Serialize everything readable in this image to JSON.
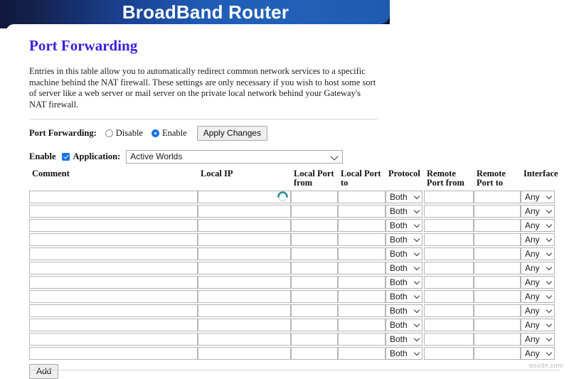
{
  "header": {
    "title": "BroadBand Router"
  },
  "page": {
    "title": "Port Forwarding",
    "description": "Entries in this table allow you to automatically redirect common network services to a specific machine behind the NAT firewall. These settings are only necessary if you wish to host some sort of server like a web server or mail server on the private local network behind your Gateway's NAT firewall."
  },
  "controls": {
    "port_forwarding_label": "Port Forwarding:",
    "disable_label": "Disable",
    "enable_label": "Enable",
    "selected_mode": "Enable",
    "apply_label": "Apply Changes",
    "enable_checkbox_label": "Enable",
    "enable_checkbox_checked": true,
    "application_label": "Application:",
    "application_value": "Active Worlds"
  },
  "table": {
    "headers": [
      "Comment",
      "Local IP",
      "Local Port from",
      "Local Port to",
      "Protocol",
      "Remote Port from",
      "Remote Port to",
      "Interface"
    ],
    "row_count": 12,
    "protocol_value": "Both",
    "interface_value": "Any",
    "rows": [
      {
        "comment": "",
        "local_ip": "",
        "local_port_from": "",
        "local_port_to": "",
        "protocol": "Both",
        "remote_port_from": "",
        "remote_port_to": "",
        "interface": "Any",
        "loading": true
      },
      {
        "comment": "",
        "local_ip": "",
        "local_port_from": "",
        "local_port_to": "",
        "protocol": "Both",
        "remote_port_from": "",
        "remote_port_to": "",
        "interface": "Any",
        "loading": false
      },
      {
        "comment": "",
        "local_ip": "",
        "local_port_from": "",
        "local_port_to": "",
        "protocol": "Both",
        "remote_port_from": "",
        "remote_port_to": "",
        "interface": "Any",
        "loading": false
      },
      {
        "comment": "",
        "local_ip": "",
        "local_port_from": "",
        "local_port_to": "",
        "protocol": "Both",
        "remote_port_from": "",
        "remote_port_to": "",
        "interface": "Any",
        "loading": false
      },
      {
        "comment": "",
        "local_ip": "",
        "local_port_from": "",
        "local_port_to": "",
        "protocol": "Both",
        "remote_port_from": "",
        "remote_port_to": "",
        "interface": "Any",
        "loading": false
      },
      {
        "comment": "",
        "local_ip": "",
        "local_port_from": "",
        "local_port_to": "",
        "protocol": "Both",
        "remote_port_from": "",
        "remote_port_to": "",
        "interface": "Any",
        "loading": false
      },
      {
        "comment": "",
        "local_ip": "",
        "local_port_from": "",
        "local_port_to": "",
        "protocol": "Both",
        "remote_port_from": "",
        "remote_port_to": "",
        "interface": "Any",
        "loading": false
      },
      {
        "comment": "",
        "local_ip": "",
        "local_port_from": "",
        "local_port_to": "",
        "protocol": "Both",
        "remote_port_from": "",
        "remote_port_to": "",
        "interface": "Any",
        "loading": false
      },
      {
        "comment": "",
        "local_ip": "",
        "local_port_from": "",
        "local_port_to": "",
        "protocol": "Both",
        "remote_port_from": "",
        "remote_port_to": "",
        "interface": "Any",
        "loading": false
      },
      {
        "comment": "",
        "local_ip": "",
        "local_port_from": "",
        "local_port_to": "",
        "protocol": "Both",
        "remote_port_from": "",
        "remote_port_to": "",
        "interface": "Any",
        "loading": false
      },
      {
        "comment": "",
        "local_ip": "",
        "local_port_from": "",
        "local_port_to": "",
        "protocol": "Both",
        "remote_port_from": "",
        "remote_port_to": "",
        "interface": "Any",
        "loading": false
      },
      {
        "comment": "",
        "local_ip": "",
        "local_port_from": "",
        "local_port_to": "",
        "protocol": "Both",
        "remote_port_from": "",
        "remote_port_to": "",
        "interface": "Any",
        "loading": false
      }
    ]
  },
  "actions": {
    "add_label": "Add"
  },
  "footer": {
    "watermark": "wsxdn.com"
  },
  "colors": {
    "accent_blue": "#1f5bb5",
    "title_purple": "#3a1fe0",
    "control_blue": "#1673e8",
    "spinner_teal": "#2e8b93",
    "page_dark": "#11193a"
  }
}
